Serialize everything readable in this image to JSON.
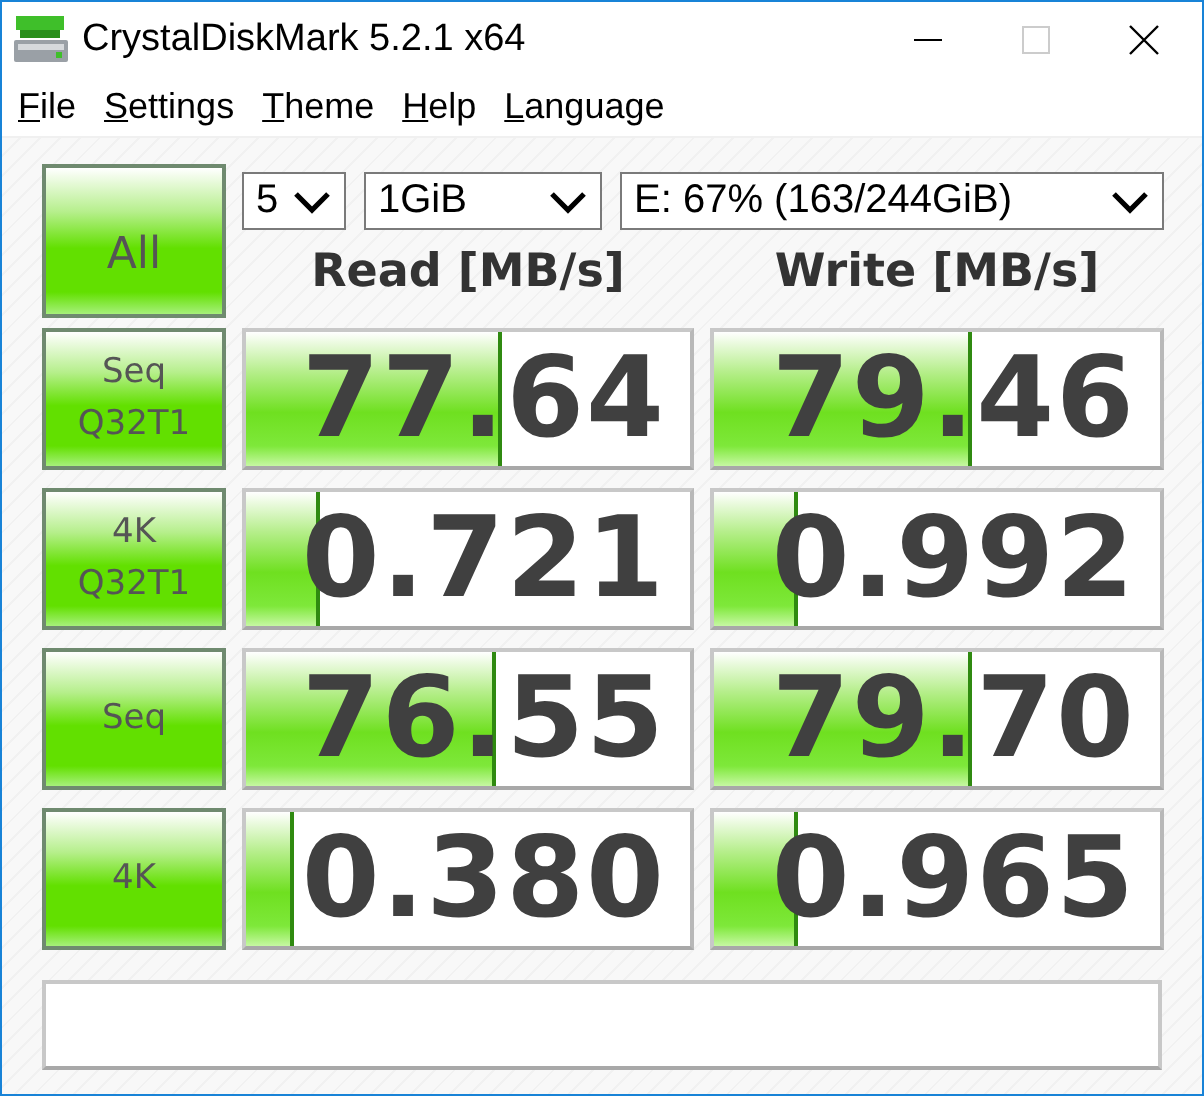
{
  "window": {
    "title": "CrystalDiskMark 5.2.1 x64"
  },
  "menu": [
    "File",
    "Settings",
    "Theme",
    "Help",
    "Language"
  ],
  "controls": {
    "all_button": "All",
    "count": "5",
    "size": "1GiB",
    "drive": "E: 67% (163/244GiB)"
  },
  "columns": [
    "Read [MB/s]",
    "Write [MB/s]"
  ],
  "tests": [
    {
      "label": [
        "Seq",
        "Q32T1"
      ],
      "read": {
        "value": "77.64",
        "level": 0.575
      },
      "write": {
        "value": "79.46",
        "level": 0.58
      }
    },
    {
      "label": [
        "4K",
        "Q32T1"
      ],
      "read": {
        "value": "0.721",
        "level": 0.165
      },
      "write": {
        "value": "0.992",
        "level": 0.19
      }
    },
    {
      "label": [
        "Seq"
      ],
      "read": {
        "value": "76.55",
        "level": 0.565
      },
      "write": {
        "value": "79.70",
        "level": 0.58
      }
    },
    {
      "label": [
        "4K"
      ],
      "read": {
        "value": "0.380",
        "level": 0.11
      },
      "write": {
        "value": "0.965",
        "level": 0.19
      }
    }
  ]
}
